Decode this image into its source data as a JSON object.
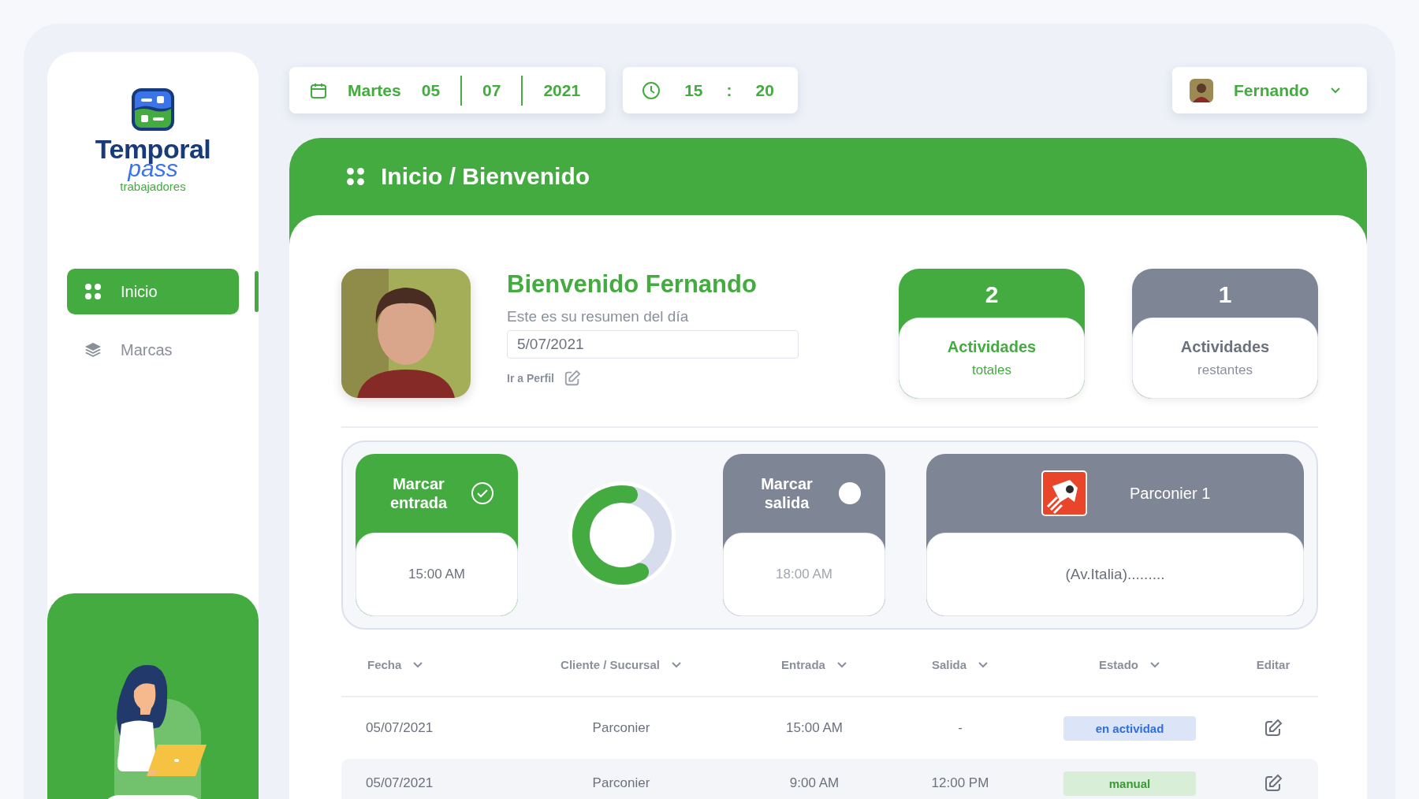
{
  "brand": {
    "name": "Temporal",
    "sub": "pass",
    "tagline": "trabajadores"
  },
  "nav": [
    {
      "label": "Inicio",
      "selected": true
    },
    {
      "label": "Marcas",
      "selected": false
    }
  ],
  "date": {
    "weekday": "Martes",
    "day": "05",
    "month": "07",
    "year": "2021"
  },
  "time": {
    "hour": "15",
    "separator": ":",
    "minute": "20"
  },
  "user": {
    "name": "Fernando"
  },
  "header": {
    "title": "Inicio / Bienvenido"
  },
  "welcome": {
    "title": "Bienvenido Fernando",
    "subtitle": "Este es su resumen del día",
    "date_value": "5/07/2021",
    "profile_link": "Ir a Perfil"
  },
  "stats": [
    {
      "value": "2",
      "label": "Actividades",
      "sub": "totales",
      "kind": "primary"
    },
    {
      "value": "1",
      "label": "Actividades",
      "sub": "restantes",
      "kind": "secondary"
    }
  ],
  "marks": [
    {
      "title": "Marcar entrada",
      "time": "15:00 AM",
      "done": true
    },
    {
      "title": "Marcar salida",
      "time": "18:00 AM",
      "done": false
    }
  ],
  "progress": {
    "level": 0.6
  },
  "site": {
    "name": "Parconier 1",
    "address": "(Av.Italia)........."
  },
  "table": {
    "columns": [
      {
        "label": "Fecha",
        "sortable": true
      },
      {
        "label": "Cliente / Sucursal",
        "sortable": true
      },
      {
        "label": "Entrada",
        "sortable": true
      },
      {
        "label": "Salida",
        "sortable": true
      },
      {
        "label": "Estado",
        "sortable": true
      },
      {
        "label": "Editar",
        "sortable": false
      }
    ],
    "rows": [
      {
        "cells": [
          "05/07/2021",
          "Parconier",
          "15:00 AM",
          "-"
        ],
        "status": "en actividad",
        "kind": "active"
      },
      {
        "cells": [
          "05/07/2021",
          "Parconier",
          "9:00 AM",
          "12:00 PM"
        ],
        "status": "manual",
        "kind": "manual"
      }
    ]
  }
}
